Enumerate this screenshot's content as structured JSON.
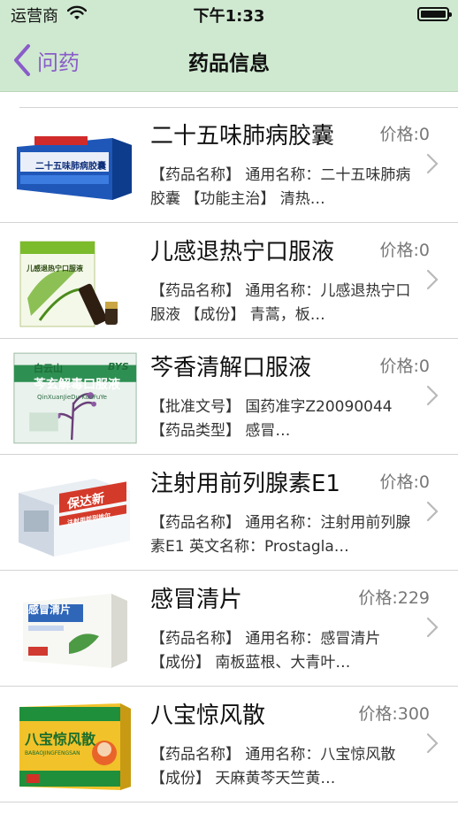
{
  "status_bar": {
    "carrier": "运营商",
    "time": "下午1:33"
  },
  "nav": {
    "back_label": "问药",
    "title": "药品信息"
  },
  "drugs": [
    {
      "name": "二十五味肺病胶囊",
      "price": "价格:0",
      "desc": "【药品名称】 通用名称：二十五味肺病胶囊 【功能主治】 清热…",
      "package_text": "二十五味肺病胶囊"
    },
    {
      "name": "儿感退热宁口服液",
      "price": "价格:0",
      "desc": "【药品名称】 通用名称：儿感退热宁口服液 【成份】 青蒿，板…",
      "package_text": "儿感退热宁口服液"
    },
    {
      "name": "芩香清解口服液",
      "price": "价格:0",
      "desc": "【批准文号】 国药准字Z20090044 【药品类型】 感冒…",
      "package_text": "芩玄解毒口服液",
      "package_brand": "白云山",
      "package_brand2": "BYS",
      "package_pinyin": "QinXuanJieDu KouFuYe"
    },
    {
      "name": "注射用前列腺素E1",
      "price": "价格:0",
      "desc": "【药品名称】 通用名称：注射用前列腺素E1 英文名称：Prostagla…",
      "package_text": "保达新",
      "package_sub": "注射用前列地尔"
    },
    {
      "name": "感冒清片",
      "price": "价格:229",
      "desc": "【药品名称】 通用名称：感冒清片 【成份】 南板蓝根、大青叶…",
      "package_text": "感冒清片"
    },
    {
      "name": "八宝惊风散",
      "price": "价格:300",
      "desc": "【药品名称】 通用名称：八宝惊风散 【成份】 天麻黄芩天竺黄…",
      "package_text": "八宝惊风散",
      "package_pinyin": "BABAOJINGFENGSAN"
    }
  ],
  "colors": {
    "header_bg": "#cfe9d0",
    "back_accent": "#8a5cc9",
    "price_text": "#777777",
    "divider": "#d3d3d3"
  }
}
